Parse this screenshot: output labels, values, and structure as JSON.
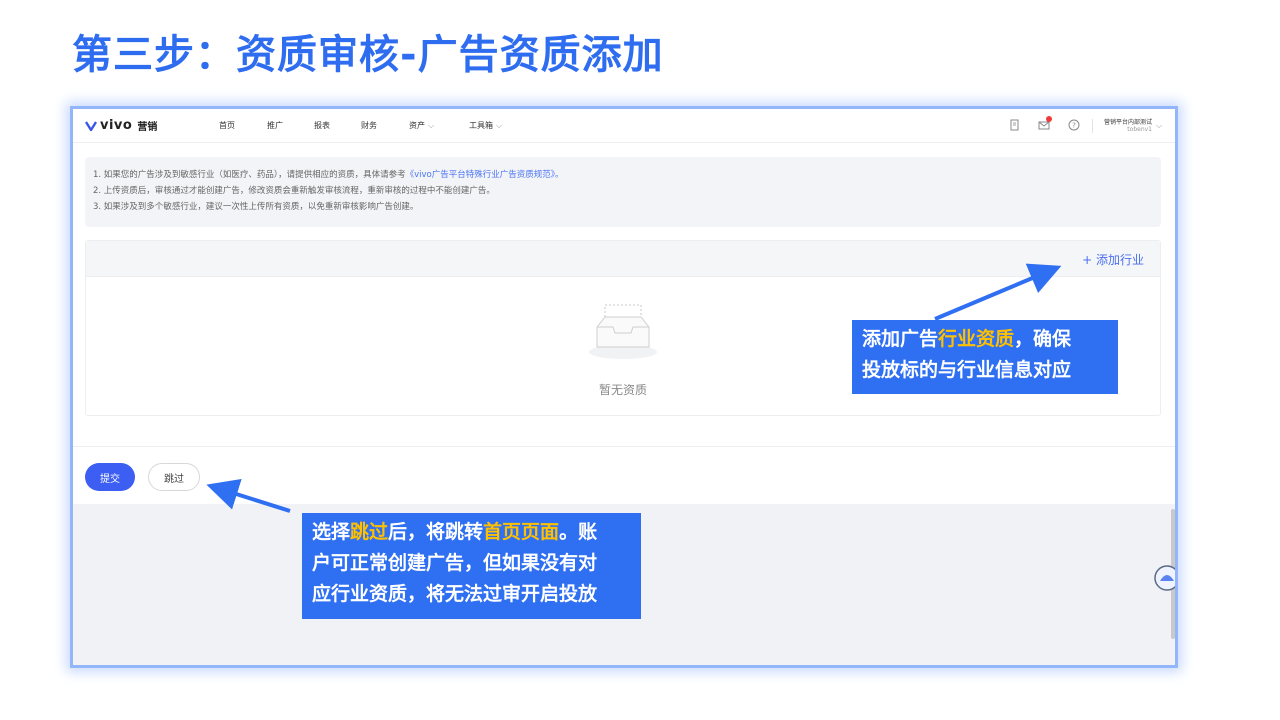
{
  "slide": {
    "title": "第三步：资质审核-广告资质添加"
  },
  "topbar": {
    "logo_text": "vivo",
    "logo_suffix": "营销",
    "nav": [
      {
        "label": "首页"
      },
      {
        "label": "推广"
      },
      {
        "label": "报表"
      },
      {
        "label": "财务"
      },
      {
        "label": "资产"
      },
      {
        "label": "工具箱"
      }
    ],
    "account_name": "营销平台内部测试",
    "account_id": "tobenv1"
  },
  "notice": {
    "line1_prefix": "1. 如果您的广告涉及到敏感行业（如医疗、药品），请提供相应的资质，具体请参考",
    "line1_link": "《vivo广告平台特殊行业广告资质规范》",
    "line1_suffix": "。",
    "line2": "2. 上传资质后，审核通过才能创建广告，修改资质会重新触发审核流程，重新审核的过程中不能创建广告。",
    "line3": "3. 如果涉及到多个敏感行业，建议一次性上传所有资质，以免重新审核影响广告创建。"
  },
  "panel": {
    "add_label": "+ 添加行业",
    "empty_text": "暂无资质"
  },
  "actions": {
    "submit_label": "提交",
    "skip_label": "跳过"
  },
  "callout1": {
    "l1_a": "添加广告",
    "l1_hl": "行业资质",
    "l1_b": "，确保",
    "l2": "投放标的与行业信息对应"
  },
  "callout2": {
    "l1_a": "选择",
    "l1_hl1": "跳过",
    "l1_b": "后，将跳转",
    "l1_hl2": "首页页面",
    "l1_c": "。账",
    "l2": "户可正常创建广告，但如果没有对",
    "l3": "应行业资质，将无法过审开启投放"
  },
  "colors": {
    "title": "#2f6df0",
    "callout_bg": "#2f6ff2",
    "highlight": "#ffc000",
    "primary_button": "#3c5ef2",
    "link": "#4a74f5"
  },
  "icons": {
    "logo": "vivo-chevron-logo",
    "doc": "document-icon",
    "mail": "mail-icon",
    "help": "help-circle-icon",
    "empty": "empty-inbox-icon",
    "helper": "helper-bot-icon"
  }
}
